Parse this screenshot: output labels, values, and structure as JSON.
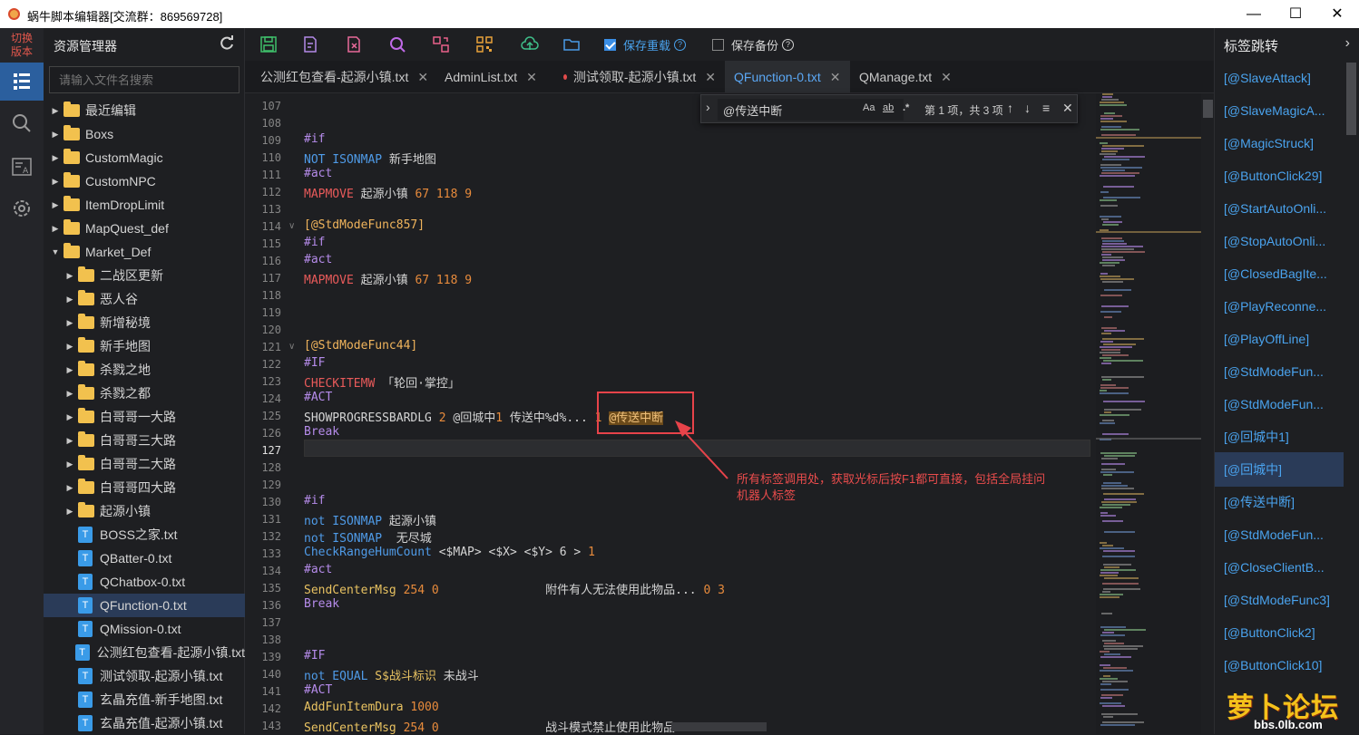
{
  "window": {
    "title": "蜗牛脚本编辑器[交流群：869569728]",
    "min": "—",
    "max": "☐",
    "close": "✕"
  },
  "activity": {
    "switch_label_1": "切换",
    "switch_label_2": "版本"
  },
  "explorer": {
    "title": "资源管理器",
    "search_placeholder": "请输入文件名搜索",
    "tree": [
      {
        "type": "folder",
        "indent": 0,
        "label": "最近编辑",
        "expanded": false
      },
      {
        "type": "folder",
        "indent": 0,
        "label": "Boxs",
        "expanded": false
      },
      {
        "type": "folder",
        "indent": 0,
        "label": "CustomMagic",
        "expanded": false
      },
      {
        "type": "folder",
        "indent": 0,
        "label": "CustomNPC",
        "expanded": false
      },
      {
        "type": "folder",
        "indent": 0,
        "label": "ItemDropLimit",
        "expanded": false
      },
      {
        "type": "folder",
        "indent": 0,
        "label": "MapQuest_def",
        "expanded": false
      },
      {
        "type": "folder",
        "indent": 0,
        "label": "Market_Def",
        "expanded": true
      },
      {
        "type": "folder",
        "indent": 1,
        "label": "二战区更新",
        "expanded": false
      },
      {
        "type": "folder",
        "indent": 1,
        "label": "恶人谷",
        "expanded": false
      },
      {
        "type": "folder",
        "indent": 1,
        "label": "新增秘境",
        "expanded": false
      },
      {
        "type": "folder",
        "indent": 1,
        "label": "新手地图",
        "expanded": false
      },
      {
        "type": "folder",
        "indent": 1,
        "label": "杀戮之地",
        "expanded": false
      },
      {
        "type": "folder",
        "indent": 1,
        "label": "杀戮之都",
        "expanded": false
      },
      {
        "type": "folder",
        "indent": 1,
        "label": "白哥哥一大路",
        "expanded": false
      },
      {
        "type": "folder",
        "indent": 1,
        "label": "白哥哥三大路",
        "expanded": false
      },
      {
        "type": "folder",
        "indent": 1,
        "label": "白哥哥二大路",
        "expanded": false
      },
      {
        "type": "folder",
        "indent": 1,
        "label": "白哥哥四大路",
        "expanded": false
      },
      {
        "type": "folder",
        "indent": 1,
        "label": "起源小镇",
        "expanded": false
      },
      {
        "type": "file",
        "indent": 1,
        "label": "BOSS之家.txt"
      },
      {
        "type": "file",
        "indent": 1,
        "label": "QBatter-0.txt"
      },
      {
        "type": "file",
        "indent": 1,
        "label": "QChatbox-0.txt"
      },
      {
        "type": "file",
        "indent": 1,
        "label": "QFunction-0.txt",
        "selected": true
      },
      {
        "type": "file",
        "indent": 1,
        "label": "QMission-0.txt"
      },
      {
        "type": "file",
        "indent": 1,
        "label": "公测红包查看-起源小镇.txt"
      },
      {
        "type": "file",
        "indent": 1,
        "label": "测试领取-起源小镇.txt"
      },
      {
        "type": "file",
        "indent": 1,
        "label": "玄晶充值-新手地图.txt"
      },
      {
        "type": "file",
        "indent": 1,
        "label": "玄晶充值-起源小镇.txt"
      }
    ],
    "file_icon_glyph": "T"
  },
  "toolbar": {
    "save_reload_label": "保存重载",
    "save_reload_checked": true,
    "save_backup_label": "保存备份",
    "save_backup_checked": false,
    "help_glyph": "?"
  },
  "tabs": [
    {
      "label": "公测红包查看-起源小镇.txt",
      "modified": true,
      "active": false
    },
    {
      "label": "AdminList.txt",
      "modified": false,
      "active": false
    },
    {
      "label": "测试领取-起源小镇.txt",
      "modified": true,
      "active": false
    },
    {
      "label": "QFunction-0.txt",
      "modified": false,
      "active": true
    },
    {
      "label": "QManage.txt",
      "modified": false,
      "active": false
    }
  ],
  "find": {
    "query": "@传送中断",
    "opt_case": "Aa",
    "opt_word": "ab",
    "opt_regex": ".*",
    "count": "第 1 项，共 3 项",
    "prev": "↑",
    "next": "↓",
    "selection": "≡",
    "close": "✕",
    "toggle": "›"
  },
  "editor": {
    "lines": [
      {
        "n": "107",
        "tokens": []
      },
      {
        "n": "108",
        "tokens": []
      },
      {
        "n": "109",
        "tokens": [
          {
            "t": "#if",
            "c": "k-purple"
          }
        ]
      },
      {
        "n": "110",
        "tokens": [
          {
            "t": "NOT ISONMAP",
            "c": "k-blue"
          },
          {
            "t": " 新手地图",
            "c": ""
          }
        ]
      },
      {
        "n": "111",
        "tokens": [
          {
            "t": "#act",
            "c": "k-purple"
          }
        ]
      },
      {
        "n": "112",
        "tokens": [
          {
            "t": "MAPMOVE",
            "c": "k-red"
          },
          {
            "t": " 起源小镇 ",
            "c": ""
          },
          {
            "t": "67 118 9",
            "c": "k-orange"
          }
        ]
      },
      {
        "n": "113",
        "tokens": []
      },
      {
        "n": "114",
        "fold": true,
        "tokens": [
          {
            "t": "[@StdModeFunc857]",
            "c": "k-gold"
          }
        ]
      },
      {
        "n": "115",
        "tokens": [
          {
            "t": "#if",
            "c": "k-purple"
          }
        ]
      },
      {
        "n": "116",
        "tokens": [
          {
            "t": "#act",
            "c": "k-purple"
          }
        ]
      },
      {
        "n": "117",
        "tokens": [
          {
            "t": "MAPMOVE",
            "c": "k-red"
          },
          {
            "t": " 起源小镇 ",
            "c": ""
          },
          {
            "t": "67 118 9",
            "c": "k-orange"
          }
        ]
      },
      {
        "n": "118",
        "tokens": []
      },
      {
        "n": "119",
        "tokens": []
      },
      {
        "n": "120",
        "tokens": []
      },
      {
        "n": "121",
        "fold": true,
        "tokens": [
          {
            "t": "[@StdModeFunc44]",
            "c": "k-gold"
          }
        ]
      },
      {
        "n": "122",
        "tokens": [
          {
            "t": "#IF",
            "c": "k-purple"
          }
        ]
      },
      {
        "n": "123",
        "tokens": [
          {
            "t": "CHECKITEMW",
            "c": "k-red"
          },
          {
            "t": " 「轮回·掌控」",
            "c": ""
          }
        ]
      },
      {
        "n": "124",
        "tokens": [
          {
            "t": "#ACT",
            "c": "k-purple"
          }
        ]
      },
      {
        "n": "125",
        "tokens": [
          {
            "t": "SHOWPROGRESSBARDLG",
            "c": ""
          },
          {
            "t": " 2 ",
            "c": "k-orange"
          },
          {
            "t": "@回城中",
            "c": ""
          },
          {
            "t": "1",
            "c": "k-orange"
          },
          {
            "t": " 传送中%d%... ",
            "c": ""
          },
          {
            "t": "1",
            "c": "k-orange"
          },
          {
            "t": " ",
            "c": ""
          },
          {
            "t": "@传送中断",
            "c": "hl-match"
          }
        ]
      },
      {
        "n": "126",
        "tokens": [
          {
            "t": "Break",
            "c": "k-purple"
          }
        ]
      },
      {
        "n": "127",
        "current": true,
        "tokens": []
      },
      {
        "n": "128",
        "tokens": []
      },
      {
        "n": "129",
        "tokens": []
      },
      {
        "n": "130",
        "tokens": [
          {
            "t": "#if",
            "c": "k-purple"
          }
        ]
      },
      {
        "n": "131",
        "tokens": [
          {
            "t": "not ISONMAP",
            "c": "k-blue"
          },
          {
            "t": " 起源小镇",
            "c": ""
          }
        ]
      },
      {
        "n": "132",
        "tokens": [
          {
            "t": "not ISONMAP",
            "c": "k-blue"
          },
          {
            "t": "  无尽城",
            "c": ""
          }
        ]
      },
      {
        "n": "133",
        "tokens": [
          {
            "t": "CheckRangeHumCount",
            "c": "k-blue"
          },
          {
            "t": " <$MAP> <$X> <$Y> 6 > ",
            "c": ""
          },
          {
            "t": "1",
            "c": "k-orange"
          }
        ]
      },
      {
        "n": "134",
        "tokens": [
          {
            "t": "#act",
            "c": "k-purple"
          }
        ]
      },
      {
        "n": "135",
        "tokens": [
          {
            "t": "SendCenterMsg",
            "c": "k-yellow"
          },
          {
            "t": " 254 0",
            "c": "k-orange"
          },
          {
            "t": "               附件有人无法使用此物品... ",
            "c": ""
          },
          {
            "t": "0 3",
            "c": "k-orange"
          }
        ]
      },
      {
        "n": "136",
        "tokens": [
          {
            "t": "Break",
            "c": "k-purple"
          }
        ]
      },
      {
        "n": "137",
        "tokens": []
      },
      {
        "n": "138",
        "tokens": []
      },
      {
        "n": "139",
        "tokens": [
          {
            "t": "#IF",
            "c": "k-purple"
          }
        ]
      },
      {
        "n": "140",
        "tokens": [
          {
            "t": "not EQUAL",
            "c": "k-blue"
          },
          {
            "t": " S$战斗标识",
            "c": "k-yellow"
          },
          {
            "t": " 未战斗",
            "c": ""
          }
        ]
      },
      {
        "n": "141",
        "tokens": [
          {
            "t": "#ACT",
            "c": "k-purple"
          }
        ]
      },
      {
        "n": "142",
        "tokens": [
          {
            "t": "AddFunItemDura",
            "c": "k-yellow"
          },
          {
            "t": " 1000",
            "c": "k-orange"
          }
        ]
      },
      {
        "n": "143",
        "tokens": [
          {
            "t": "SendCenterMsg",
            "c": "k-yellow"
          },
          {
            "t": " 254 0",
            "c": "k-orange"
          },
          {
            "t": "               战斗模式禁止使用此物品... ",
            "c": ""
          },
          {
            "t": "0 3",
            "c": "k-orange"
          }
        ]
      }
    ]
  },
  "annotation": {
    "line1": "所有标签调用处，获取光标后按F1都可直接，包括全局挂问",
    "line2": "机器人标签"
  },
  "rightpanel": {
    "title": "标签跳转",
    "chevron": "›",
    "items": [
      {
        "label": "[@SlaveAttack]"
      },
      {
        "label": "[@SlaveMagicA..."
      },
      {
        "label": "[@MagicStruck]"
      },
      {
        "label": "[@ButtonClick29]"
      },
      {
        "label": "[@StartAutoOnli..."
      },
      {
        "label": "[@StopAutoOnli..."
      },
      {
        "label": "[@ClosedBagIte..."
      },
      {
        "label": "[@PlayReconne..."
      },
      {
        "label": "[@PlayOffLine]"
      },
      {
        "label": "[@StdModeFun..."
      },
      {
        "label": "[@StdModeFun..."
      },
      {
        "label": "[@回城中1]"
      },
      {
        "label": "[@回城中]",
        "active": true
      },
      {
        "label": "[@传送中断]"
      },
      {
        "label": "[@StdModeFun..."
      },
      {
        "label": "[@CloseClientB..."
      },
      {
        "label": "[@StdModeFunc3]"
      },
      {
        "label": "[@ButtonClick2]"
      },
      {
        "label": "[@ButtonClick10]"
      }
    ]
  },
  "watermark": {
    "text": "萝卜论坛",
    "sub": "bbs.0lb.com"
  },
  "colors": {
    "accent": "#3a8ee6",
    "match_highlight_border": "#e7434a"
  }
}
